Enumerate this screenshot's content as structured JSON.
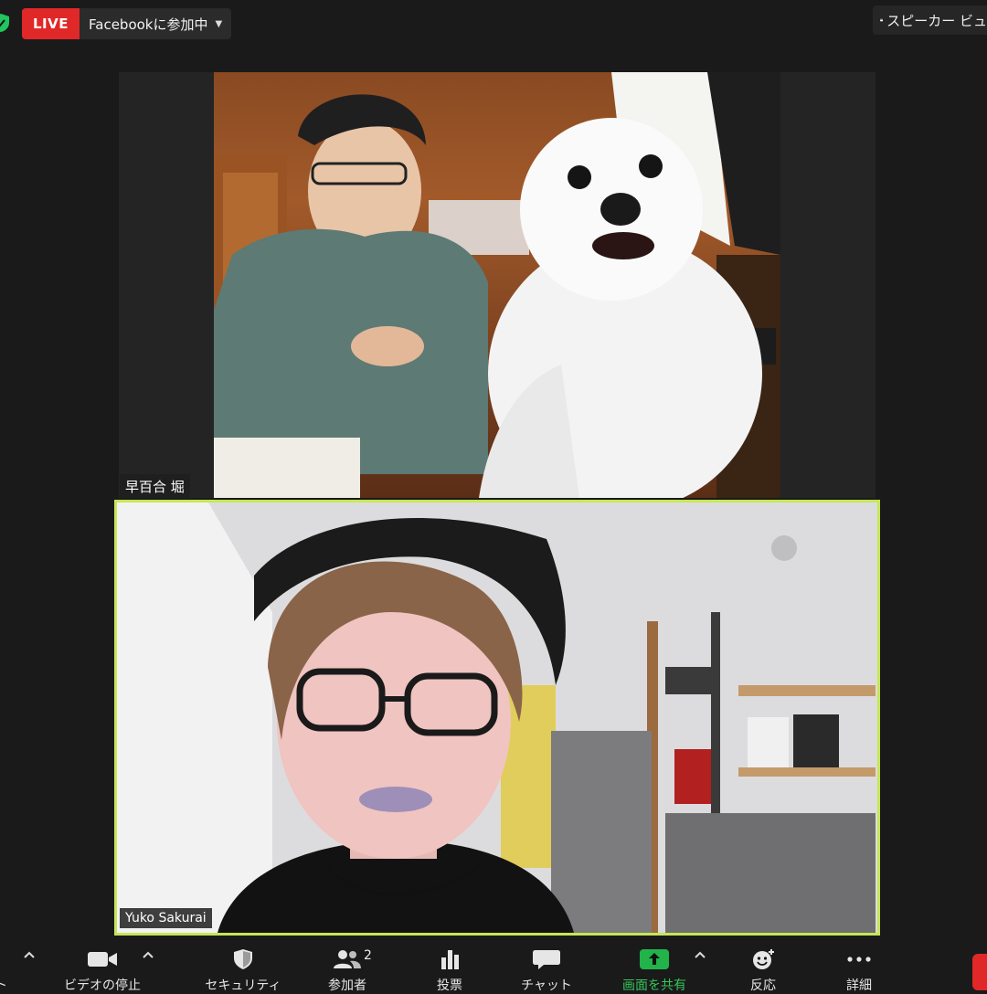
{
  "top_bar": {
    "live_badge": "LIVE",
    "live_status": "Facebookに参加中",
    "view_label": "スピーカー ビュー"
  },
  "participants": [
    {
      "name": "早百合 堀"
    },
    {
      "name": "Yuko Sakurai",
      "active_speaker": true
    }
  ],
  "toolbar": {
    "left_cut_label": "ト",
    "items": [
      {
        "label": "ビデオの停止",
        "icon": "video-camera-icon"
      },
      {
        "label": "セキュリティ",
        "icon": "shield-icon"
      },
      {
        "label": "参加者",
        "icon": "participants-icon",
        "count": "2"
      },
      {
        "label": "投票",
        "icon": "bar-chart-icon"
      },
      {
        "label": "チャット",
        "icon": "chat-bubble-icon"
      },
      {
        "label": "画面を共有",
        "icon": "share-screen-icon",
        "accent": "#34c759"
      },
      {
        "label": "反応",
        "icon": "emoji-add-icon"
      },
      {
        "label": "詳細",
        "icon": "more-dots-icon"
      }
    ]
  },
  "colors": {
    "live_red": "#e02828",
    "active_speaker_border": "#c6e657",
    "share_green": "#34c759"
  }
}
